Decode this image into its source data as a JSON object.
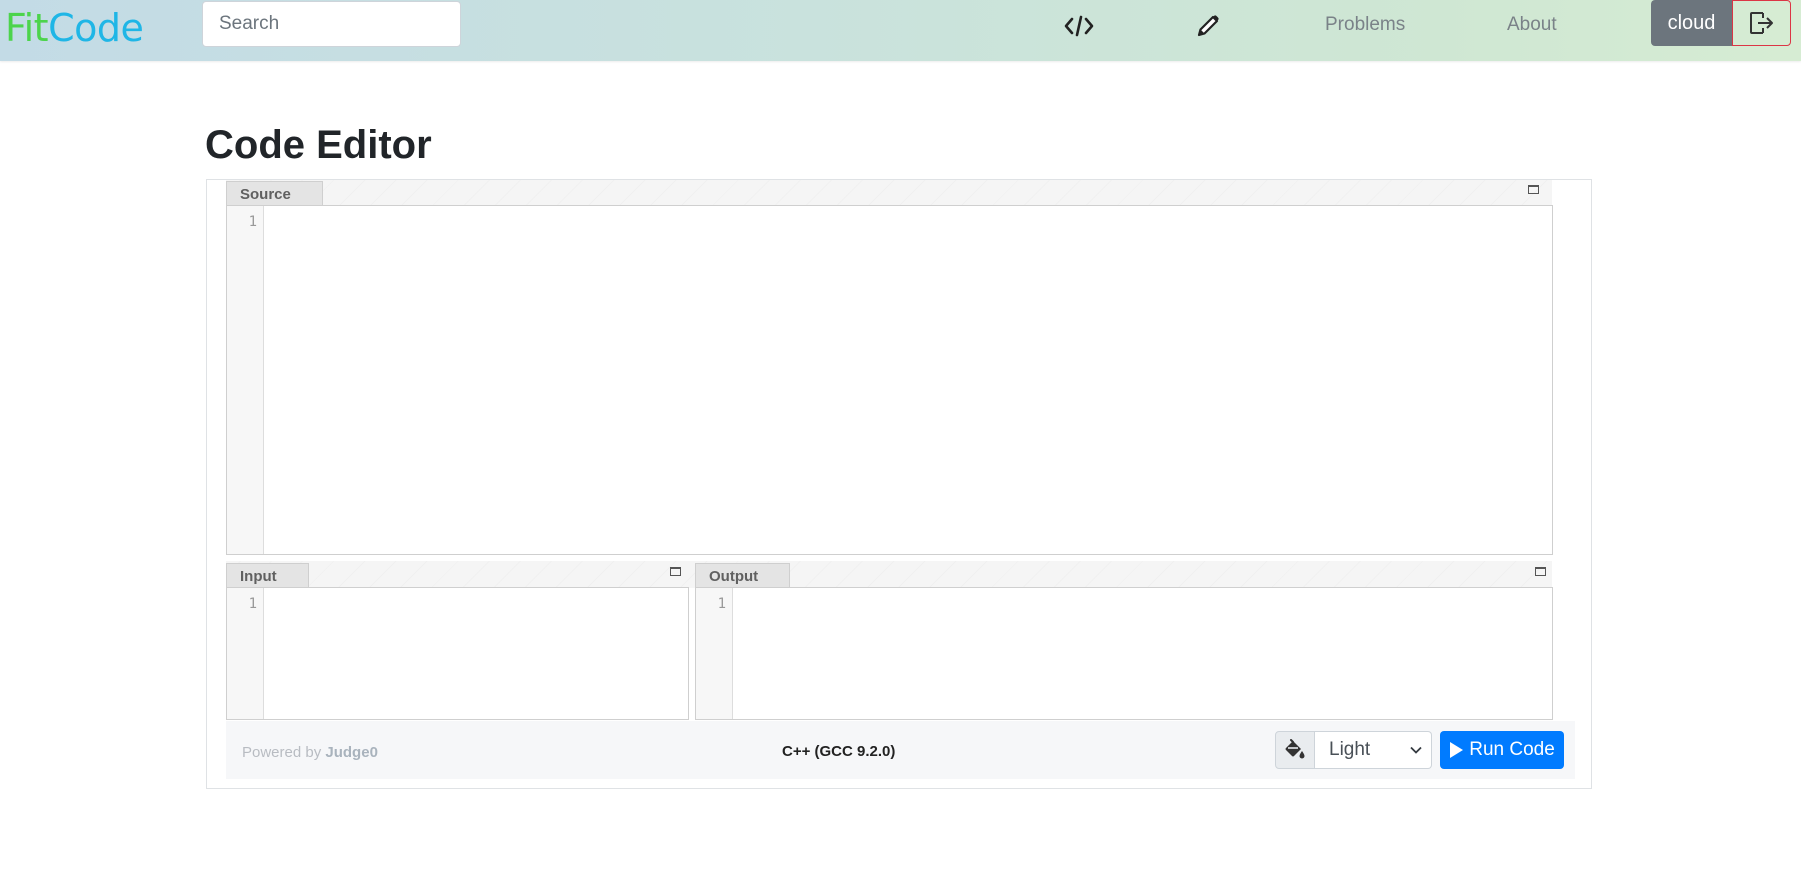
{
  "navbar": {
    "brand_fit": "Fit",
    "brand_code": "Code",
    "search_placeholder": "Search",
    "icons": [
      "code-icon",
      "pencil-icon"
    ],
    "links": [
      "Problems",
      "About"
    ],
    "username": "cloud",
    "logout_icon": "logout-icon"
  },
  "page": {
    "title": "Code Editor"
  },
  "editor": {
    "source": {
      "title": "Source",
      "line_numbers": [
        "1"
      ]
    },
    "input": {
      "title": "Input",
      "line_numbers": [
        "1"
      ]
    },
    "output": {
      "title": "Output",
      "line_numbers": [
        "1"
      ]
    }
  },
  "footer": {
    "powered_prefix": "Powered by",
    "powered_name": "Judge0",
    "language": "C++ (GCC 9.2.0)",
    "theme_icon": "paint-bucket-icon",
    "theme_value": "Light",
    "run_label": "Run Code"
  },
  "colors": {
    "brand_fit": "#4cd44c",
    "brand_code": "#1fb6e6",
    "run_button": "#007bff",
    "user_button": "#6c757d",
    "logout_border": "#dc3545"
  }
}
